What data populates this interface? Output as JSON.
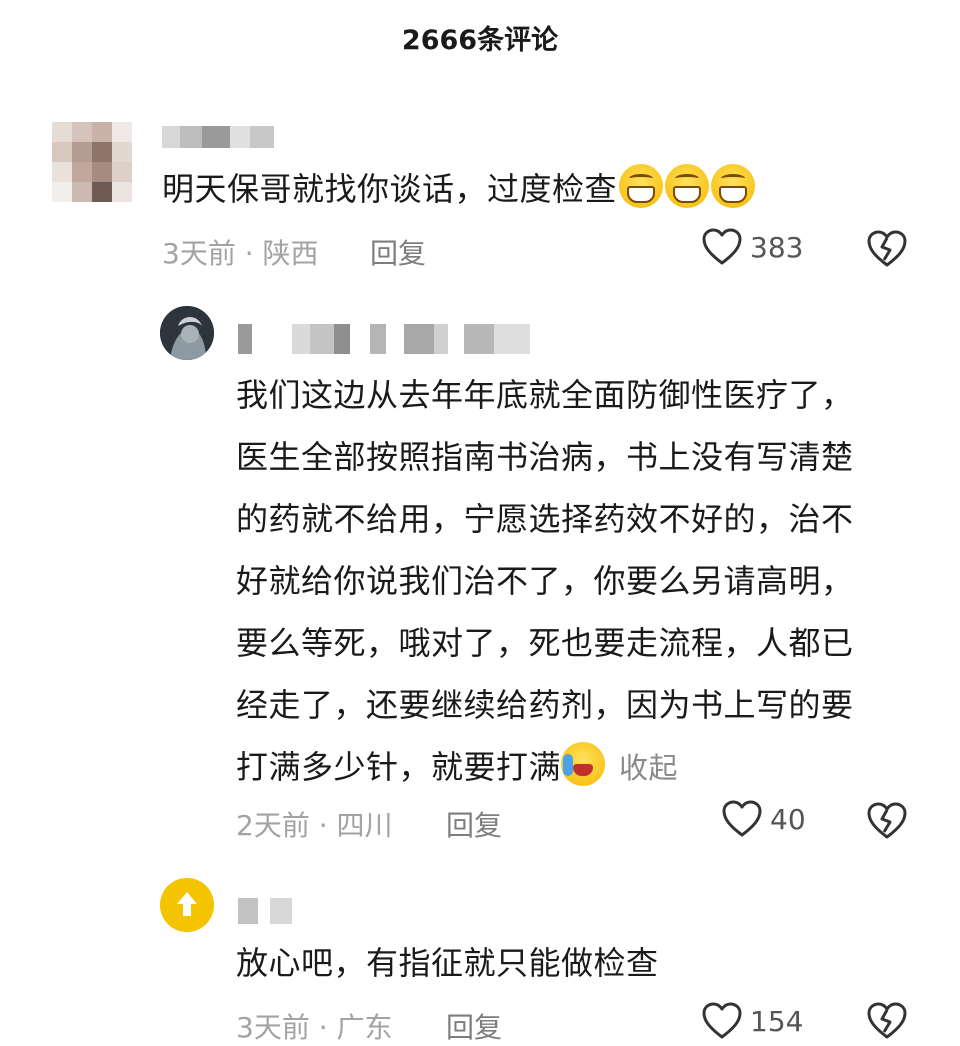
{
  "header": {
    "title": "2666条评论"
  },
  "comments": [
    {
      "text": "明天保哥就找你谈话，过度检查",
      "time_location": "3天前 · 陕西",
      "reply_label": "回复",
      "like_count": "383"
    },
    {
      "lines": [
        "我们这边从去年年底就全面防御性医疗了，",
        "医生全部按照指南书治病，书上没有写清楚",
        "的药就不给用，宁愿选择药效不好的，治不",
        "好就给你说我们治不了，你要么另请高明，",
        "要么等死，哦对了，死也要走流程，人都已",
        "经走了，还要继续给药剂，因为书上写的要",
        "打满多少针，就要打满"
      ],
      "collapse_label": "收起",
      "time_location": "2天前 · 四川",
      "reply_label": "回复",
      "like_count": "40"
    },
    {
      "text": "放心吧，有指征就只能做检查",
      "time_location": "3天前 · 广东",
      "reply_label": "回复",
      "like_count": "154"
    }
  ],
  "colors": {
    "meta_text": "#a3a3a3",
    "reply_text": "#7d7d7d",
    "icon_stroke": "#333333",
    "avatar3_bg": "#f5c400"
  },
  "icons": {
    "like": "heart-outline-icon",
    "dislike": "broken-heart-icon",
    "emoji_grin": "grinning-face-icon",
    "emoji_cry": "crying-laughing-face-icon",
    "avatar3": "arrow-up-icon"
  }
}
